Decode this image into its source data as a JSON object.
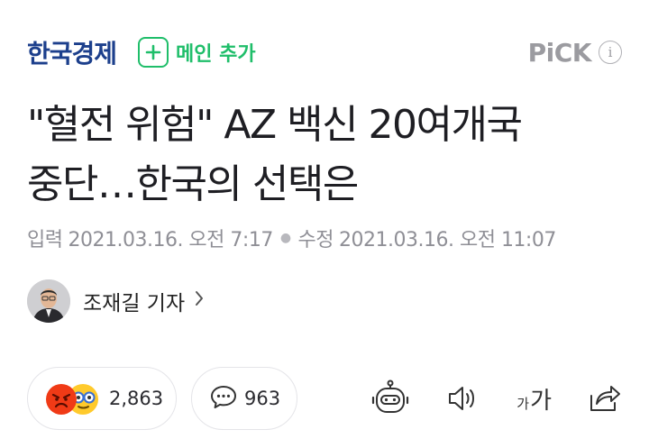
{
  "header": {
    "press_name": "한국경제",
    "add_main_label": "메인 추가",
    "pick_label": "PiCK",
    "info_glyph": "i"
  },
  "article": {
    "title_line1": "\"혈전 위험\" AZ 백신 20여개국",
    "title_line2": "중단…한국의 선택은",
    "input_label": "입력",
    "input_date": "2021.03.16. 오전 7:17",
    "modified_label": "수정",
    "modified_date": "2021.03.16. 오전 11:07",
    "reporter": "조재길 기자"
  },
  "actions": {
    "reaction_count": "2,863",
    "comment_count": "963",
    "font_small_glyph": "가",
    "font_large_glyph": "가"
  },
  "colors": {
    "press_blue": "#1c3f8c",
    "add_green": "#1fbe6a",
    "muted_gray": "#8f8f96",
    "angry_red": "#f03a16",
    "emoji_yellow": "#ffca2c"
  },
  "icons": [
    "plus-icon",
    "info-icon",
    "angry-emoji-icon",
    "glasses-emoji-icon",
    "comment-icon",
    "summary-bot-icon",
    "speaker-icon",
    "font-size-icon",
    "share-icon",
    "chevron-right-icon"
  ]
}
